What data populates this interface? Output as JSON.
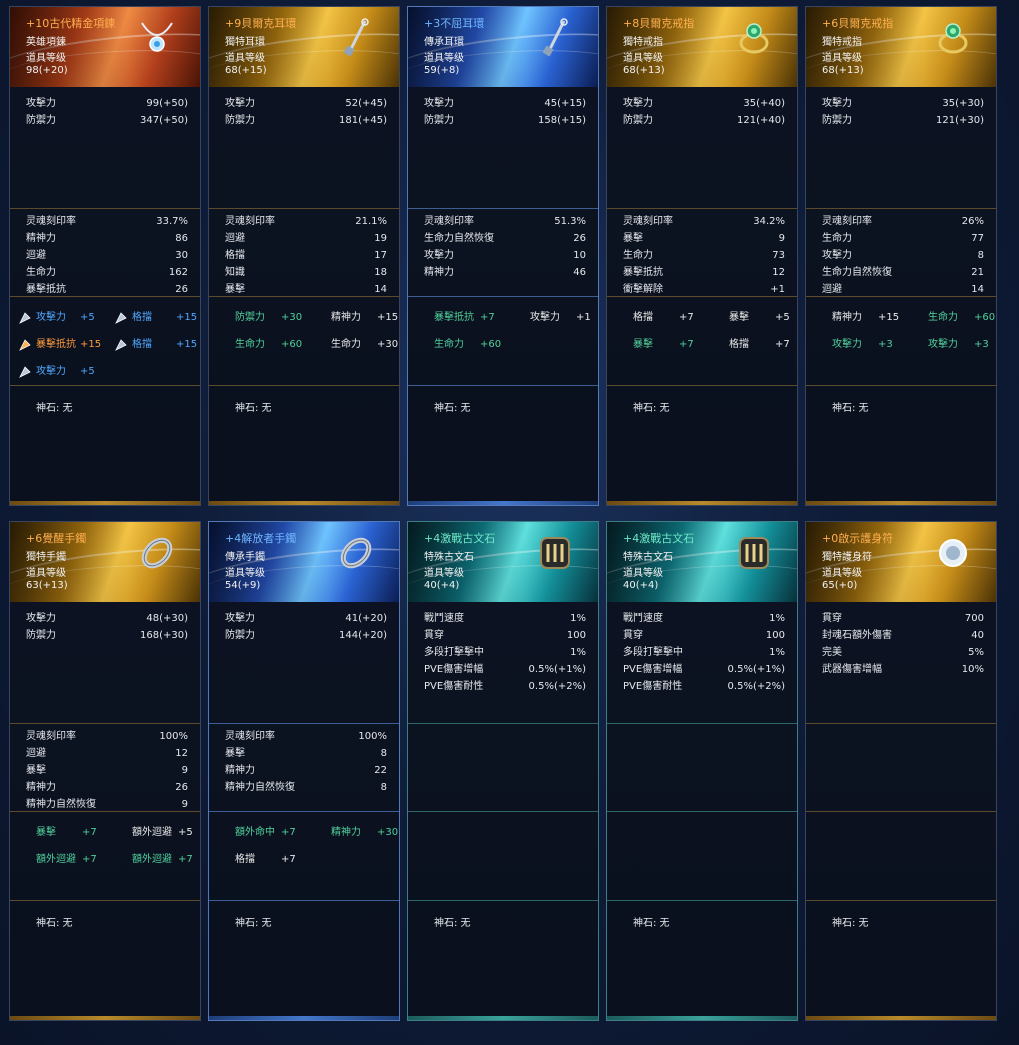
{
  "cards": [
    {
      "name": "+10古代精金項鍊",
      "type": "英雄項鍊",
      "level_label": "道具等级",
      "level": "98(+20)",
      "theme": "orange",
      "icon": "necklace-icon",
      "base": [
        [
          "攻擊力",
          "99(+50)"
        ],
        [
          "防禦力",
          "347(+50)"
        ]
      ],
      "sub": [
        [
          "灵魂刻印率",
          "33.7%"
        ],
        [
          "精神力",
          "86"
        ],
        [
          "迴避",
          "30"
        ],
        [
          "生命力",
          "162"
        ],
        [
          "暴擊抵抗",
          "26"
        ]
      ],
      "gems": [
        {
          "k": "攻擊力",
          "v": "+5",
          "c": "blue"
        },
        {
          "k": "格擋",
          "v": "+15",
          "c": "blue"
        },
        {
          "k": "暴擊抵抗",
          "v": "+15",
          "c": "orange"
        },
        {
          "k": "格擋",
          "v": "+15",
          "c": "blue"
        },
        {
          "k": "攻擊力",
          "v": "+5",
          "c": "blue"
        }
      ],
      "godstone": "神石: 无"
    },
    {
      "name": "+9貝爾克耳環",
      "type": "獨特耳環",
      "level_label": "道具等级",
      "level": "68(+15)",
      "theme": "gold",
      "icon": "earring-icon",
      "base": [
        [
          "攻擊力",
          "52(+45)"
        ],
        [
          "防禦力",
          "181(+45)"
        ]
      ],
      "sub": [
        [
          "灵魂刻印率",
          "21.1%"
        ],
        [
          "迴避",
          "19"
        ],
        [
          "格擋",
          "17"
        ],
        [
          "知識",
          "18"
        ],
        [
          "暴擊",
          "14"
        ]
      ],
      "gems": [
        {
          "k": "防禦力",
          "v": "+30",
          "c": "green"
        },
        {
          "k": "精神力",
          "v": "+15",
          "c": "white"
        },
        {
          "k": "生命力",
          "v": "+60",
          "c": "green"
        },
        {
          "k": "生命力",
          "v": "+30",
          "c": "white"
        }
      ],
      "godstone": "神石: 无"
    },
    {
      "name": "+3不屈耳環",
      "type": "傳承耳環",
      "level_label": "道具等级",
      "level": "59(+8)",
      "theme": "blue",
      "icon": "earring-icon",
      "base": [
        [
          "攻擊力",
          "45(+15)"
        ],
        [
          "防禦力",
          "158(+15)"
        ]
      ],
      "sub": [
        [
          "灵魂刻印率",
          "51.3%"
        ],
        [
          "生命力自然恢復",
          "26"
        ],
        [
          "攻擊力",
          "10"
        ],
        [
          "精神力",
          "46"
        ]
      ],
      "gems": [
        {
          "k": "暴擊抵抗",
          "v": "+7",
          "c": "green"
        },
        {
          "k": "攻擊力",
          "v": "+1",
          "c": "white"
        },
        {
          "k": "生命力",
          "v": "+60",
          "c": "green"
        }
      ],
      "godstone": "神石: 无"
    },
    {
      "name": "+8貝爾克戒指",
      "type": "獨特戒指",
      "level_label": "道具等级",
      "level": "68(+13)",
      "theme": "gold",
      "icon": "ring-icon",
      "base": [
        [
          "攻擊力",
          "35(+40)"
        ],
        [
          "防禦力",
          "121(+40)"
        ]
      ],
      "sub": [
        [
          "灵魂刻印率",
          "34.2%"
        ],
        [
          "暴擊",
          "9"
        ],
        [
          "生命力",
          "73"
        ],
        [
          "暴擊抵抗",
          "12"
        ],
        [
          "衝擊解除",
          "+1"
        ]
      ],
      "gems": [
        {
          "k": "格擋",
          "v": "+7",
          "c": "white"
        },
        {
          "k": "暴擊",
          "v": "+5",
          "c": "white"
        },
        {
          "k": "暴擊",
          "v": "+7",
          "c": "green"
        },
        {
          "k": "格擋",
          "v": "+7",
          "c": "white"
        }
      ],
      "godstone": "神石: 无"
    },
    {
      "name": "+6貝爾克戒指",
      "type": "獨特戒指",
      "level_label": "道具等级",
      "level": "68(+13)",
      "theme": "gold",
      "icon": "ring-icon",
      "base": [
        [
          "攻擊力",
          "35(+30)"
        ],
        [
          "防禦力",
          "121(+30)"
        ]
      ],
      "sub": [
        [
          "灵魂刻印率",
          "26%"
        ],
        [
          "生命力",
          "77"
        ],
        [
          "攻擊力",
          "8"
        ],
        [
          "生命力自然恢復",
          "21"
        ],
        [
          "迴避",
          "14"
        ]
      ],
      "gems": [
        {
          "k": "精神力",
          "v": "+15",
          "c": "white"
        },
        {
          "k": "生命力",
          "v": "+60",
          "c": "green"
        },
        {
          "k": "攻擊力",
          "v": "+3",
          "c": "green"
        },
        {
          "k": "攻擊力",
          "v": "+3",
          "c": "green"
        }
      ],
      "godstone": "神石: 无"
    },
    {
      "name": "+6覺醒手鐲",
      "type": "獨特手鐲",
      "level_label": "道具等级",
      "level": "63(+13)",
      "theme": "gold",
      "icon": "bracelet-icon",
      "base": [
        [
          "攻擊力",
          "48(+30)"
        ],
        [
          "防禦力",
          "168(+30)"
        ]
      ],
      "sub": [
        [
          "灵魂刻印率",
          "100%"
        ],
        [
          "迴避",
          "12"
        ],
        [
          "暴擊",
          "9"
        ],
        [
          "精神力",
          "26"
        ],
        [
          "精神力自然恢復",
          "9"
        ]
      ],
      "gems": [
        {
          "k": "暴擊",
          "v": "+7",
          "c": "green"
        },
        {
          "k": "額外迴避",
          "v": "+5",
          "c": "white"
        },
        {
          "k": "額外迴避",
          "v": "+7",
          "c": "green"
        },
        {
          "k": "額外迴避",
          "v": "+7",
          "c": "green"
        }
      ],
      "godstone": "神石: 无"
    },
    {
      "name": "+4解放者手鐲",
      "type": "傳承手鐲",
      "level_label": "道具等级",
      "level": "54(+9)",
      "theme": "blue",
      "icon": "bracelet-icon",
      "base": [
        [
          "攻擊力",
          "41(+20)"
        ],
        [
          "防禦力",
          "144(+20)"
        ]
      ],
      "sub": [
        [
          "灵魂刻印率",
          "100%"
        ],
        [
          "暴擊",
          "8"
        ],
        [
          "精神力",
          "22"
        ],
        [
          "精神力自然恢復",
          "8"
        ]
      ],
      "gems": [
        {
          "k": "額外命中",
          "v": "+7",
          "c": "green"
        },
        {
          "k": "精神力",
          "v": "+30",
          "c": "green"
        },
        {
          "k": "格擋",
          "v": "+7",
          "c": "white"
        }
      ],
      "godstone": "神石: 无"
    },
    {
      "name": "+4激戰古文石",
      "type": "特殊古文石",
      "level_label": "道具等级",
      "level": "40(+4)",
      "theme": "teal",
      "icon": "rune-stone-icon",
      "base": [
        [
          "戰鬥速度",
          "1%"
        ],
        [
          "貫穿",
          "100"
        ],
        [
          "多段打擊擊中",
          "1%"
        ],
        [
          "PVE傷害增幅",
          "0.5%(+1%)"
        ],
        [
          "PVE傷害耐性",
          "0.5%(+2%)"
        ]
      ],
      "sub": [],
      "gems": [],
      "godstone": "神石: 无"
    },
    {
      "name": "+4激戰古文石",
      "type": "特殊古文石",
      "level_label": "道具等级",
      "level": "40(+4)",
      "theme": "teal",
      "icon": "rune-stone-icon",
      "base": [
        [
          "戰鬥速度",
          "1%"
        ],
        [
          "貫穿",
          "100"
        ],
        [
          "多段打擊擊中",
          "1%"
        ],
        [
          "PVE傷害增幅",
          "0.5%(+1%)"
        ],
        [
          "PVE傷害耐性",
          "0.5%(+2%)"
        ]
      ],
      "sub": [],
      "gems": [],
      "godstone": "神石: 无"
    },
    {
      "name": "+0啟示護身符",
      "type": "獨特護身符",
      "level_label": "道具等级",
      "level": "65(+0)",
      "theme": "gold",
      "icon": "amulet-icon",
      "base": [
        [
          "貫穿",
          "700"
        ],
        [
          "封魂石額外傷害",
          "40"
        ],
        [
          "完美",
          "5%"
        ],
        [
          "武器傷害增幅",
          "10%"
        ]
      ],
      "sub": [],
      "gems": [],
      "godstone": "神石: 无"
    }
  ],
  "colors": {
    "orange_theme": "#c0441a",
    "gold_theme": "#b07a10",
    "blue_theme": "#2857c8",
    "teal_theme": "#0f7f8b",
    "gem_blue": "#4fa7ff",
    "gem_orange": "#ff9a3b",
    "gem_green": "#4fd09b"
  }
}
